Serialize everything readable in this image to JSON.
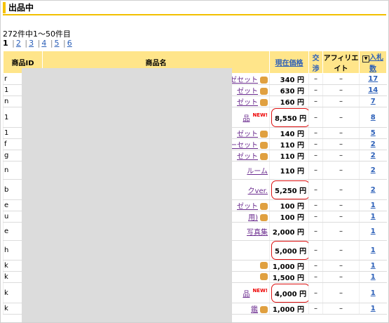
{
  "section_title": "出品中",
  "count_text": "272件中1〜50件目",
  "pager": {
    "current": "1",
    "pages": [
      "2",
      "3",
      "4",
      "5",
      "6"
    ]
  },
  "headers": {
    "id": "商品ID",
    "name": "商品名",
    "price": "現在価格",
    "trade": "交渉",
    "affiliate": "アフィリエイト",
    "bids": "入札数"
  },
  "rows": [
    {
      "id": "r",
      "name": "ゼセット",
      "icon": "hammer",
      "price": "340 円",
      "trade": "–",
      "aff": "–",
      "bids": "17"
    },
    {
      "id": "1",
      "name": "ゼット",
      "icon": "hammer",
      "price": "630 円",
      "trade": "–",
      "aff": "–",
      "bids": "14"
    },
    {
      "id": "n",
      "name": "ゼット",
      "icon": "hammer",
      "price": "160 円",
      "trade": "–",
      "aff": "–",
      "bids": "7"
    },
    {
      "id": "1",
      "name": "品",
      "icon": "new",
      "price": "8,550 円",
      "circled": true,
      "trade": "–",
      "aff": "–",
      "bids": "8"
    },
    {
      "id": "1",
      "name": "ゼット",
      "icon": "hammer",
      "price": "140 円",
      "trade": "–",
      "aff": "–",
      "bids": "5"
    },
    {
      "id": "f",
      "name": "ーセット",
      "icon": "hammer",
      "price": "110 円",
      "trade": "–",
      "aff": "–",
      "bids": "2"
    },
    {
      "id": "g",
      "name": "ゼット",
      "icon": "hammer",
      "price": "110 円",
      "trade": "–",
      "aff": "–",
      "bids": "2"
    },
    {
      "id": "n",
      "name": "ルーム",
      "icon": "",
      "price": "110 円",
      "trade": "–",
      "aff": "–",
      "bids": "2"
    },
    {
      "id": "b",
      "name": "クver.",
      "icon": "",
      "price": "5,250 円",
      "circled": true,
      "trade": "–",
      "aff": "–",
      "bids": "2"
    },
    {
      "id": "e",
      "name": "ゼット",
      "icon": "hammer",
      "price": "100 円",
      "trade": "–",
      "aff": "–",
      "bids": "1"
    },
    {
      "id": "u",
      "name": "用)",
      "icon": "hammer",
      "price": "100 円",
      "trade": "–",
      "aff": "–",
      "bids": "1"
    },
    {
      "id": "e",
      "name": "写真集",
      "icon": "",
      "price": "2,000 円",
      "trade": "–",
      "aff": "–",
      "bids": "1"
    },
    {
      "id": "h",
      "name": "",
      "icon": "",
      "price": "5,000 円",
      "circled": true,
      "trade": "–",
      "aff": "–",
      "bids": "1"
    },
    {
      "id": "k",
      "name": "",
      "icon": "hammer",
      "price": "1,000 円",
      "trade": "–",
      "aff": "–",
      "bids": "1"
    },
    {
      "id": "k",
      "name": "",
      "icon": "hammer",
      "price": "1,500 円",
      "trade": "–",
      "aff": "–",
      "bids": "1"
    },
    {
      "id": "k",
      "name": "品",
      "icon": "new",
      "price": "4,000 円",
      "circled": true,
      "trade": "–",
      "aff": "–",
      "bids": "1"
    },
    {
      "id": "k",
      "name": "鑑",
      "icon": "hammer",
      "price": "1,000 円",
      "trade": "–",
      "aff": "–",
      "bids": "1"
    }
  ]
}
